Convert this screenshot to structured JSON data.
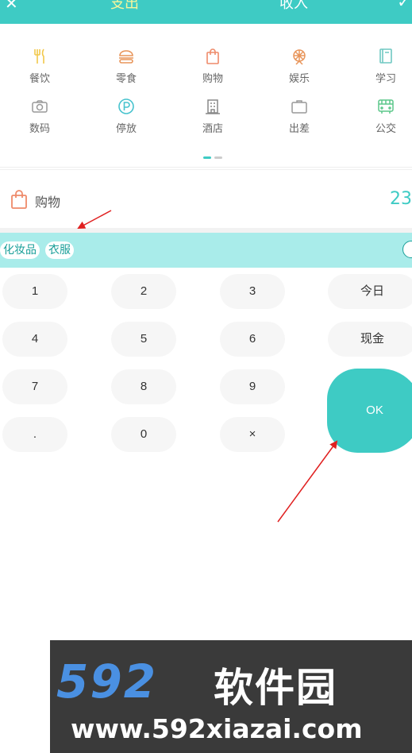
{
  "header": {
    "tab_expense": "支出",
    "tab_income": "收入",
    "close_glyph": "✕",
    "check_glyph": "✓"
  },
  "categories": [
    {
      "label": "餐饮",
      "icon": "utensils-icon",
      "color": "#f2c84b"
    },
    {
      "label": "零食",
      "icon": "burger-icon",
      "color": "#e8955a"
    },
    {
      "label": "购物",
      "icon": "shopping-bag-icon",
      "color": "#ee8a6a"
    },
    {
      "label": "娱乐",
      "icon": "ferris-wheel-icon",
      "color": "#e8955a"
    },
    {
      "label": "学习",
      "icon": "book-icon",
      "color": "#6fc8c2"
    },
    {
      "label": "数码",
      "icon": "camera-icon",
      "color": "#999999"
    },
    {
      "label": "停放",
      "icon": "parking-icon",
      "color": "#47c3ce"
    },
    {
      "label": "酒店",
      "icon": "hotel-icon",
      "color": "#888888"
    },
    {
      "label": "出差",
      "icon": "briefcase-icon",
      "color": "#999999"
    },
    {
      "label": "公交",
      "icon": "bus-icon",
      "color": "#5cc78a"
    }
  ],
  "selected": {
    "name": "购物",
    "amount": "23"
  },
  "tags": [
    "化妆品",
    "衣服"
  ],
  "keypad": {
    "keys": [
      "1",
      "2",
      "3",
      "4",
      "5",
      "6",
      "7",
      "8",
      "9",
      ".",
      "0",
      "×"
    ],
    "today": "今日",
    "cash": "现金",
    "ok": "OK"
  },
  "watermark": {
    "numeral": "592",
    "name": "软件园",
    "url": "www.592xiazai.com"
  },
  "colors": {
    "accent": "#3ecbc4",
    "tag_bar": "#a9ecea",
    "annotation": "#e02020"
  }
}
